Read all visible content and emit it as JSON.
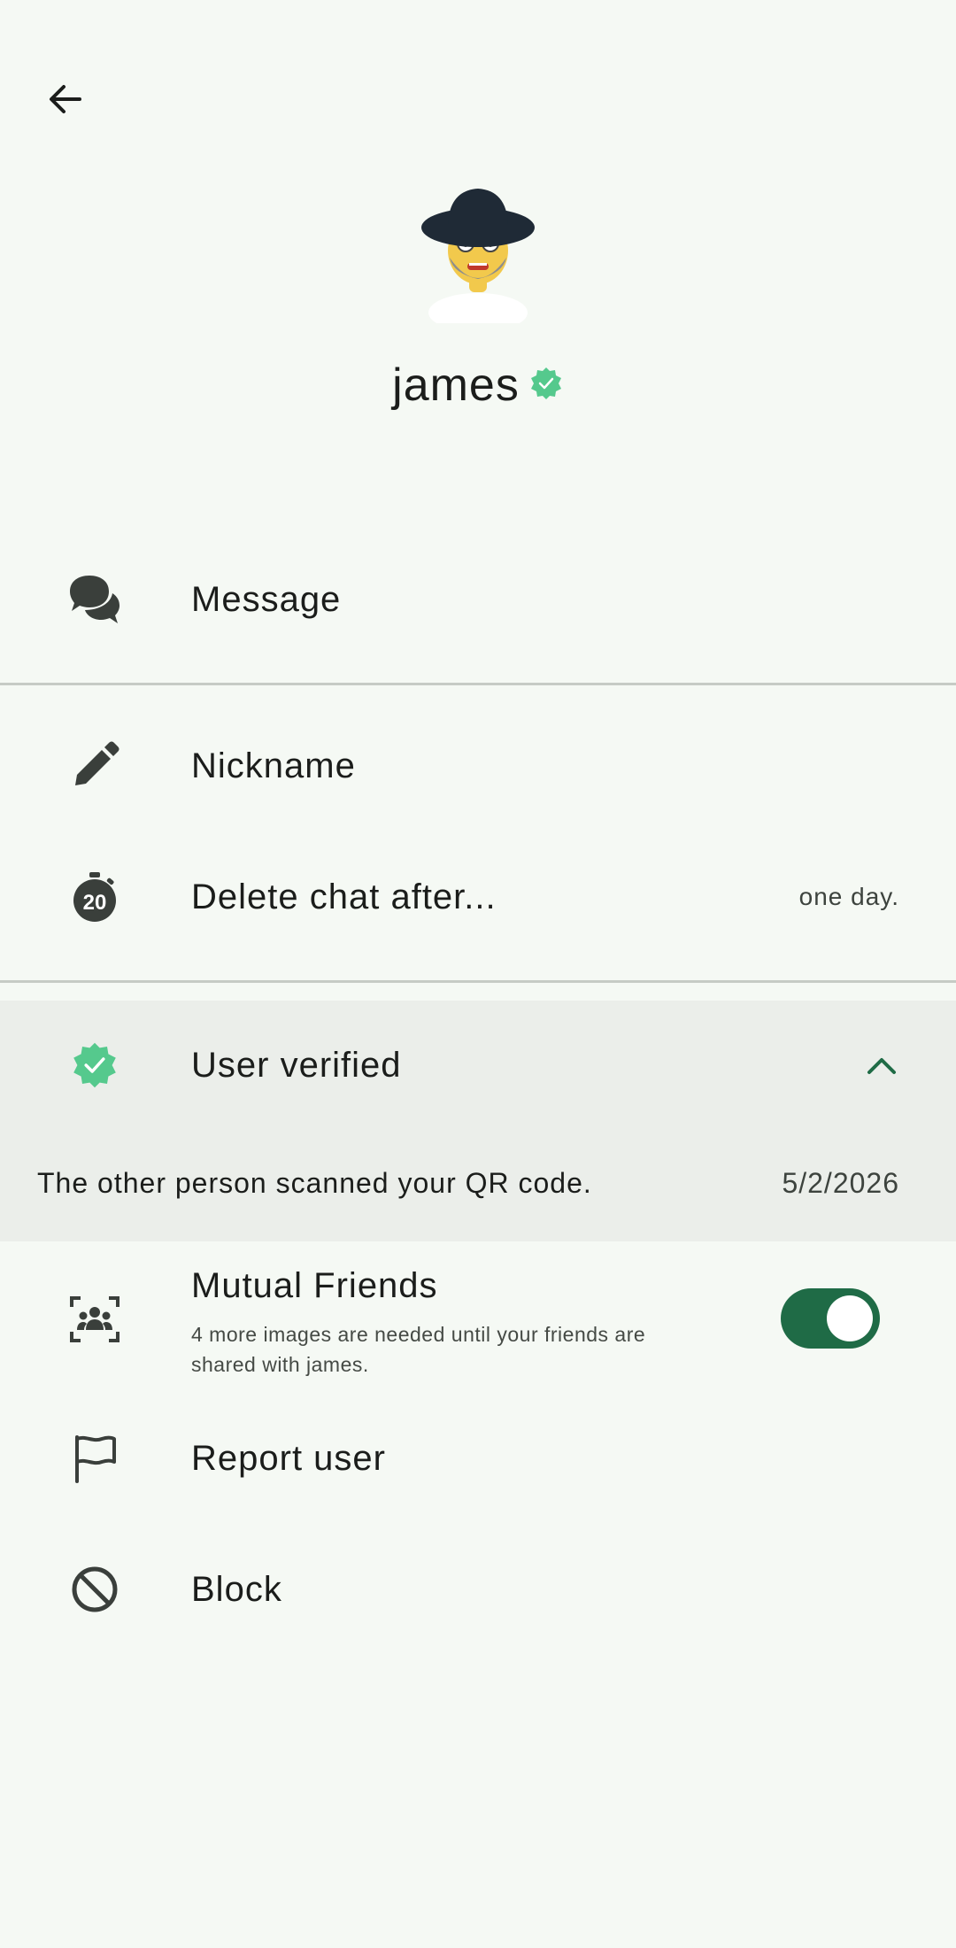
{
  "profile": {
    "name": "james",
    "verified_badge_color": "#55c98d"
  },
  "icons": {
    "back": "arrow-left-icon",
    "message": "chat-bubbles-icon",
    "nickname": "pencil-icon",
    "delete_chat": "timer-20-icon",
    "verified": "verified-badge-icon",
    "expand": "chevron-up-icon",
    "mutual_friends": "group-scan-icon",
    "report": "flag-icon",
    "block": "block-icon"
  },
  "actions": {
    "message": "Message",
    "nickname": "Nickname",
    "delete_chat": "Delete chat after...",
    "delete_chat_value": "one day.",
    "timer_badge": "20",
    "user_verified": "User verified",
    "verified_detail": "The other person scanned your QR code.",
    "verified_date": "5/2/2026",
    "mutual_friends": "Mutual Friends",
    "mutual_friends_sub": "4 more images are needed until your friends are shared with james.",
    "mutual_friends_enabled": true,
    "report_user": "Report user",
    "block": "Block"
  },
  "colors": {
    "background": "#f5f9f4",
    "accent": "#1f6b46",
    "expanded_bg": "#ebeeea",
    "icon": "#3a3f3b"
  }
}
